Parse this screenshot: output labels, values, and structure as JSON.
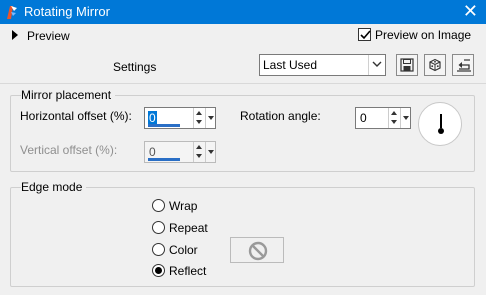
{
  "window": {
    "title": "Rotating Mirror",
    "close_glyph": "✕"
  },
  "toolbar": {
    "preview_label": "Preview",
    "preview_on_image_label": "Preview on Image",
    "preview_on_image_checked": true
  },
  "settings": {
    "label": "Settings",
    "preset_value": "Last Used",
    "buttons": [
      "save-preset-icon",
      "randomize-icon",
      "reset-icon"
    ]
  },
  "mirror_placement": {
    "title": "Mirror placement",
    "horizontal_offset": {
      "label": "Horizontal offset (%):",
      "value": "0"
    },
    "vertical_offset": {
      "label": "Vertical offset (%):",
      "value": "0",
      "enabled": false
    },
    "rotation_angle": {
      "label": "Rotation angle:",
      "value": "0"
    }
  },
  "edge_mode": {
    "title": "Edge mode",
    "options": [
      {
        "label": "Wrap",
        "selected": false
      },
      {
        "label": "Repeat",
        "selected": false
      },
      {
        "label": "Color",
        "selected": false
      },
      {
        "label": "Reflect",
        "selected": true
      }
    ],
    "color_swatch_icon": "no-color-icon"
  },
  "colors": {
    "titlebar": "#0078d7",
    "background": "#f0f0f0",
    "accent": "#2a6fc6"
  }
}
